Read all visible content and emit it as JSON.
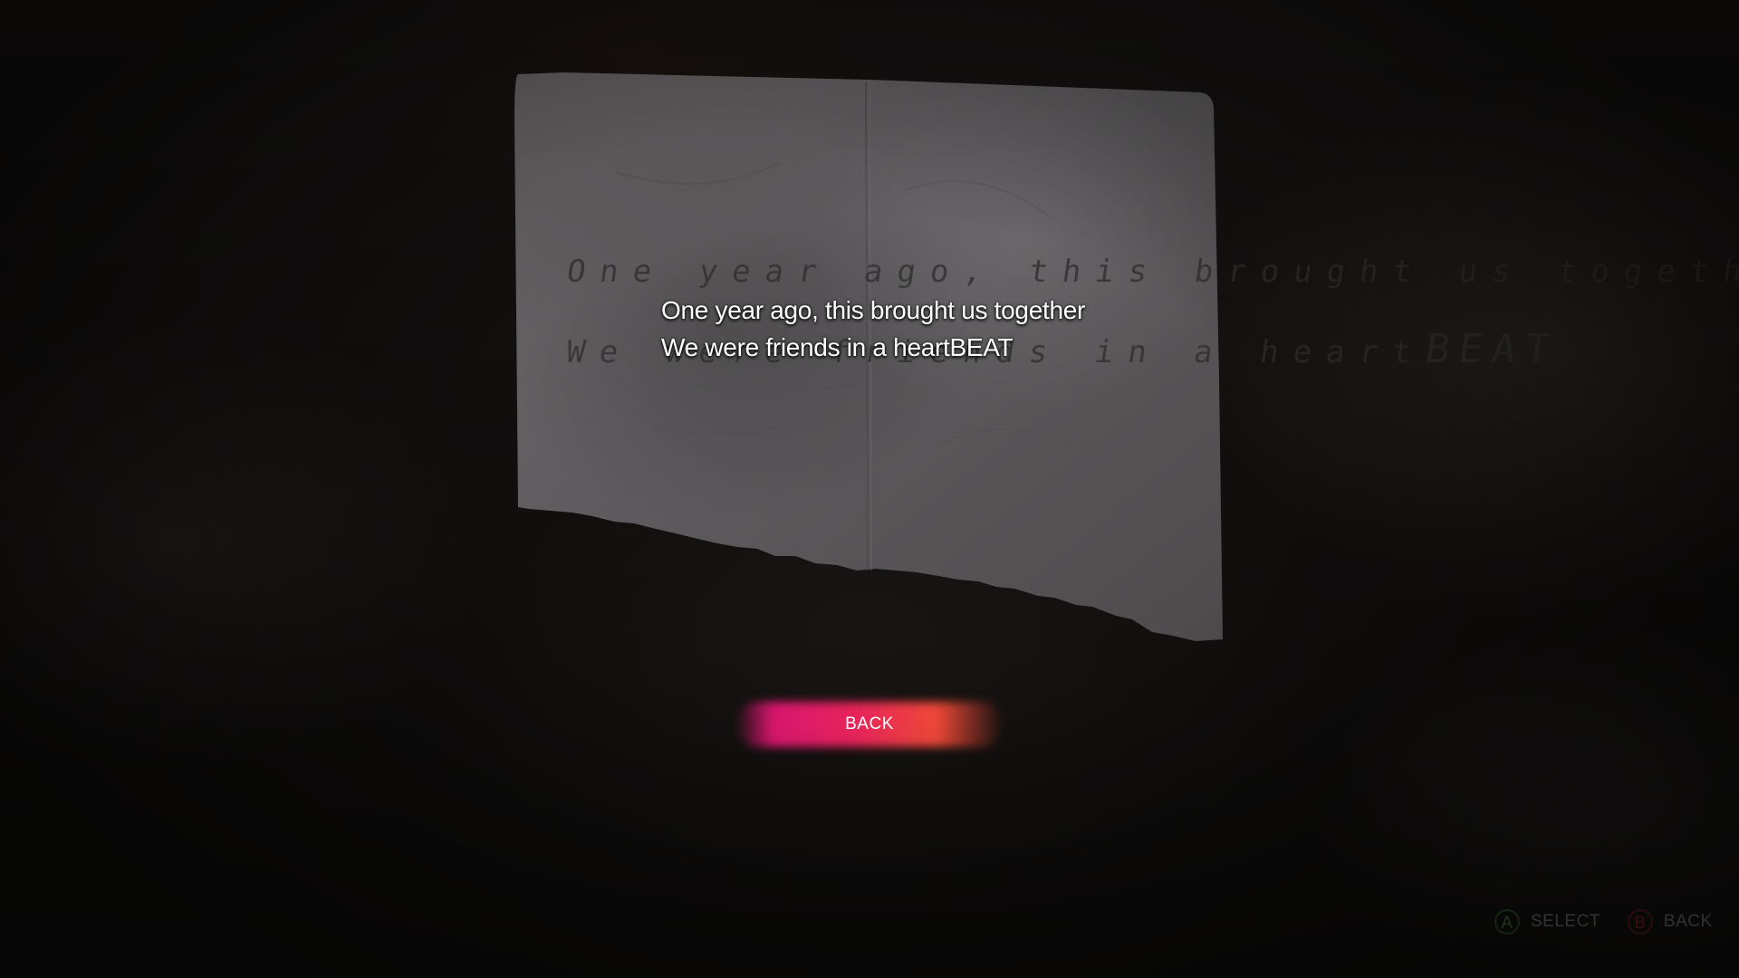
{
  "note": {
    "handwritten_line1": "One year ago, this brought us together",
    "handwritten_line2_lower": "We were friends in a heart",
    "handwritten_line2_caps": "BEAT"
  },
  "subtitle": {
    "line1": "One year ago, this brought us together",
    "line2": "We were friends in a heartBEAT"
  },
  "menu": {
    "back_label": "BACK",
    "colors": {
      "highlight_start": "#d8166e",
      "highlight_end": "#ee4838"
    }
  },
  "controller_hints": [
    {
      "button": "A",
      "label": "SELECT",
      "color": "#3f6b2f"
    },
    {
      "button": "B",
      "label": "BACK",
      "color": "#7a1e22"
    }
  ]
}
